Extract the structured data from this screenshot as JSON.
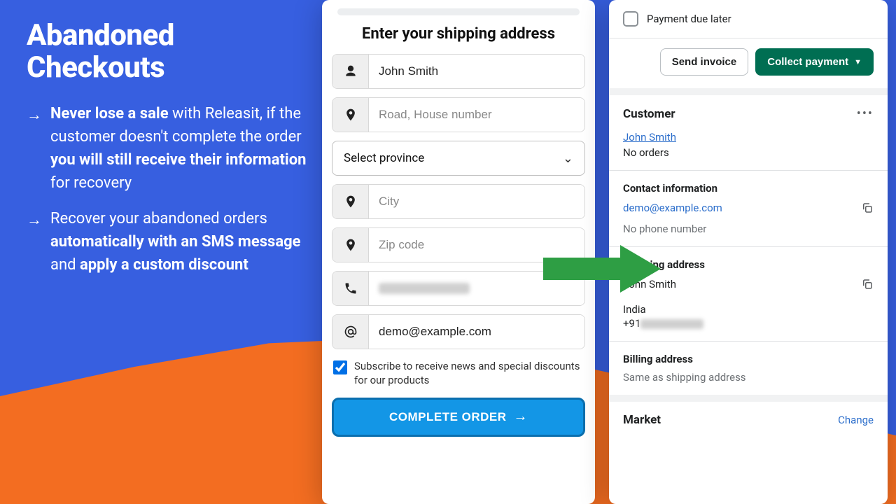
{
  "promo": {
    "title_line1": "Abandoned",
    "title_line2": "Checkouts",
    "bullet1_strong1": "Never lose a sale",
    "bullet1_part2": " with Releasit, if the customer doesn't complete the order ",
    "bullet1_strong2": "you will still receive their information",
    "bullet1_part3": " for recovery",
    "bullet2_part1": "Recover your abandoned orders ",
    "bullet2_strong1": "automatically with an SMS message",
    "bullet2_part2": " and ",
    "bullet2_strong2": "apply a custom discount"
  },
  "form": {
    "heading": "Enter your shipping address",
    "name_value": "John Smith",
    "road_placeholder": "Road, House number",
    "province_label": "Select province",
    "city_placeholder": "City",
    "zip_placeholder": "Zip code",
    "email_value": "demo@example.com",
    "subscribe_label": "Subscribe to receive news and special discounts for our products",
    "complete_label": "COMPLETE ORDER"
  },
  "admin": {
    "payment_due_label": "Payment due later",
    "send_invoice": "Send invoice",
    "collect_payment": "Collect payment",
    "customer_heading": "Customer",
    "customer_name": "John Smith",
    "no_orders": "No orders",
    "contact_heading": "Contact information",
    "contact_email": "demo@example.com",
    "no_phone": "No phone number",
    "shipping_heading": "Shipping address",
    "shipping_name": "John Smith",
    "shipping_country": "India",
    "shipping_phone_prefix": "+91",
    "billing_heading": "Billing address",
    "billing_same": "Same as shipping address",
    "market_heading": "Market",
    "change_label": "Change"
  }
}
